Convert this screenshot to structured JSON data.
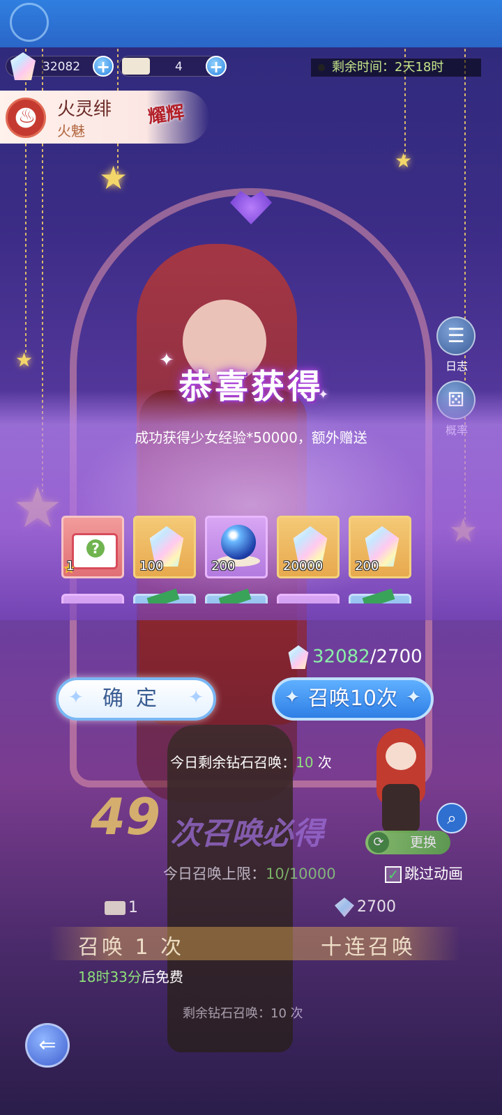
{
  "header": {
    "diamond_count": "32082",
    "ticket_count": "4",
    "timer_label": "剩余时间：",
    "timer_value": "2天18时"
  },
  "character": {
    "name": "火灵绯",
    "attribute": "火魅",
    "badge": "耀辉"
  },
  "side_buttons": [
    {
      "label": "日志",
      "icon": "log-icon"
    },
    {
      "label": "概率",
      "icon": "dice-icon"
    }
  ],
  "modal": {
    "title": "恭喜获得",
    "message": "成功获得少女经验*50000，额外赠送",
    "items": [
      {
        "icon": "mystery-box-icon",
        "qty": "1",
        "frame": "red"
      },
      {
        "icon": "diamond-icon",
        "qty": "100",
        "frame": "gold"
      },
      {
        "icon": "crystal-orb-icon",
        "qty": "200",
        "frame": "purple"
      },
      {
        "icon": "diamond-icon",
        "qty": "20000",
        "frame": "gold"
      },
      {
        "icon": "diamond-icon",
        "qty": "200",
        "frame": "gold"
      }
    ],
    "second_row_frames": [
      "purple",
      "blue",
      "blue",
      "purple",
      "blue"
    ],
    "balance_current": "32082",
    "balance_cost": "/2700",
    "confirm_label": "确定",
    "summon10_label": "召唤10次",
    "today_remain_prefix": "今日剩余钻石召唤：",
    "today_remain_value": "10",
    "today_remain_suffix": " 次"
  },
  "pity": {
    "count": "49",
    "text": "次召唤必得"
  },
  "limit": {
    "prefix": "今日召唤上限：",
    "value": "10/10000"
  },
  "swap_label": "更换",
  "skip_label": "跳过动画",
  "summon": {
    "single_cost": "1",
    "ten_cost": "2700",
    "single_label": "召唤 1 次",
    "ten_label": "十连召唤",
    "free_time": "18时33分",
    "free_suffix": "后免费",
    "remain_bottom": "剩余钻石召唤：10 次"
  },
  "colors": {
    "accent_blue": "#2f7fe6",
    "highlight_green": "#8fe07a",
    "gold": "#e6c36a"
  }
}
